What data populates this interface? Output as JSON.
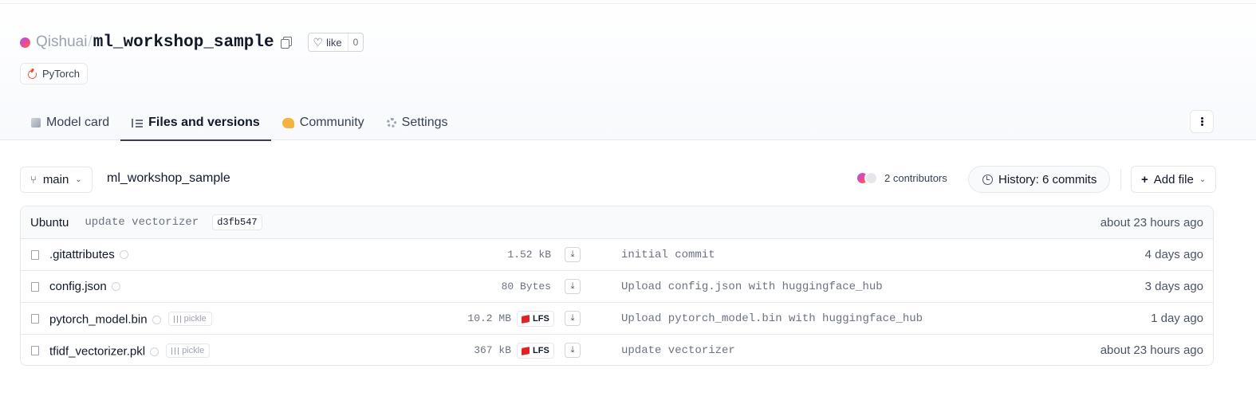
{
  "repo": {
    "owner": "Qishuai",
    "separator": "/",
    "name": "ml_workshop_sample",
    "like_label": "like",
    "like_count": "0",
    "tag": "PyTorch"
  },
  "tabs": [
    {
      "label": "Model card",
      "icon": "cube-icon"
    },
    {
      "label": "Files and versions",
      "icon": "files-icon",
      "active": true
    },
    {
      "label": "Community",
      "icon": "community-icon"
    },
    {
      "label": "Settings",
      "icon": "gear-icon"
    }
  ],
  "toolbar": {
    "branch": "main",
    "path": "ml_workshop_sample",
    "contributors": "2 contributors",
    "history": "History: 6 commits",
    "add_file": "Add file"
  },
  "last_commit": {
    "author": "Ubuntu",
    "message": "update vectorizer",
    "sha": "d3fb547",
    "time": "about 23 hours ago"
  },
  "files": [
    {
      "name": ".gitattributes",
      "size": "1.52 kB",
      "lfs": false,
      "pickle": false,
      "message": "initial commit",
      "time": "4 days ago"
    },
    {
      "name": "config.json",
      "size": "80 Bytes",
      "lfs": false,
      "pickle": false,
      "message": "Upload config.json with huggingface_hub",
      "time": "3 days ago"
    },
    {
      "name": "pytorch_model.bin",
      "size": "10.2 MB",
      "lfs": true,
      "pickle": true,
      "message": "Upload pytorch_model.bin with huggingface_hub",
      "time": "1 day ago"
    },
    {
      "name": "tfidf_vectorizer.pkl",
      "size": "367 kB",
      "lfs": true,
      "pickle": true,
      "message": "update vectorizer",
      "time": "about 23 hours ago"
    }
  ],
  "labels": {
    "pickle": "pickle",
    "lfs": "LFS"
  },
  "colors": {
    "accent_tab": "#374151",
    "pytorch": "#ee4c2c",
    "lfs": "#dc2626",
    "community": "#f4b33e"
  }
}
